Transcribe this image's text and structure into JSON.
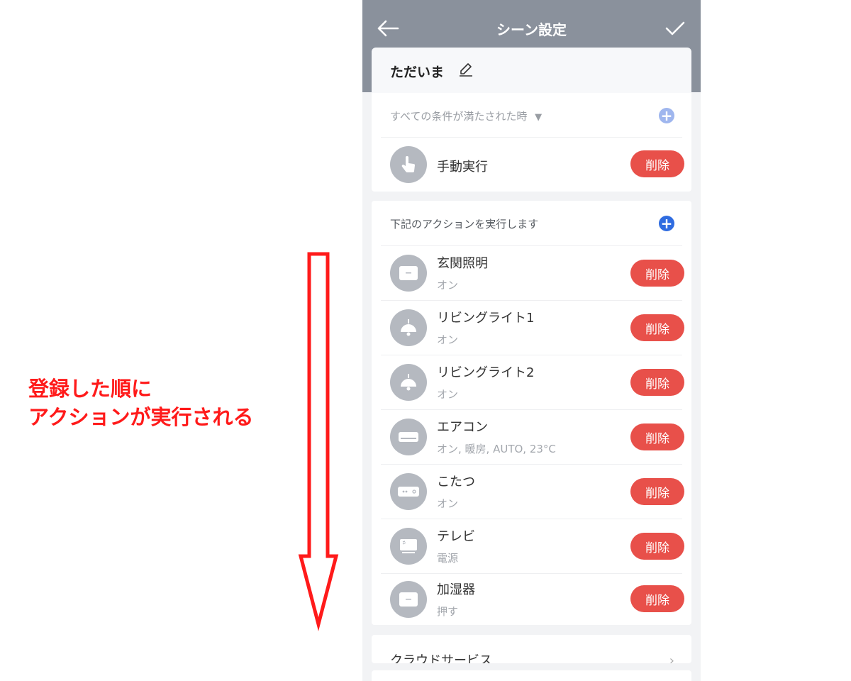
{
  "annotation": {
    "line1": "登録した順に",
    "line2": "アクションが実行される",
    "color": "#ff1a1a"
  },
  "header": {
    "title": "シーン設定",
    "back_icon": "arrow-left-icon",
    "done_icon": "check-icon",
    "background": "#8a919c"
  },
  "scene": {
    "name": "ただいま",
    "edit_icon": "pencil-icon"
  },
  "conditions": {
    "heading": "すべての条件が満たされた時",
    "items": [
      {
        "name": "手動実行",
        "icon": "hand-tap-icon",
        "delete_label": "削除"
      }
    ]
  },
  "actions": {
    "heading": "下記のアクションを実行します",
    "items": [
      {
        "name": "玄関照明",
        "detail": "オン",
        "icon": "switch-icon",
        "delete_label": "削除"
      },
      {
        "name": "リビングライト1",
        "detail": "オン",
        "icon": "pendant-light-icon",
        "delete_label": "削除"
      },
      {
        "name": "リビングライト2",
        "detail": "オン",
        "icon": "pendant-light-icon",
        "delete_label": "削除"
      },
      {
        "name": "エアコン",
        "detail": "オン, 暖房, AUTO, 23°C",
        "icon": "air-conditioner-icon",
        "delete_label": "削除"
      },
      {
        "name": "こたつ",
        "detail": "オン",
        "icon": "power-strip-icon",
        "delete_label": "削除"
      },
      {
        "name": "テレビ",
        "detail": "電源",
        "icon": "tv-icon",
        "delete_label": "削除"
      },
      {
        "name": "加湿器",
        "detail": "押す",
        "icon": "switch-icon",
        "delete_label": "削除"
      }
    ]
  },
  "cloud": {
    "label": "クラウドサービス"
  },
  "colors": {
    "delete": "#e8504a",
    "plus_active": "#2f6ce0",
    "plus_inactive": "#9fb6ee"
  }
}
